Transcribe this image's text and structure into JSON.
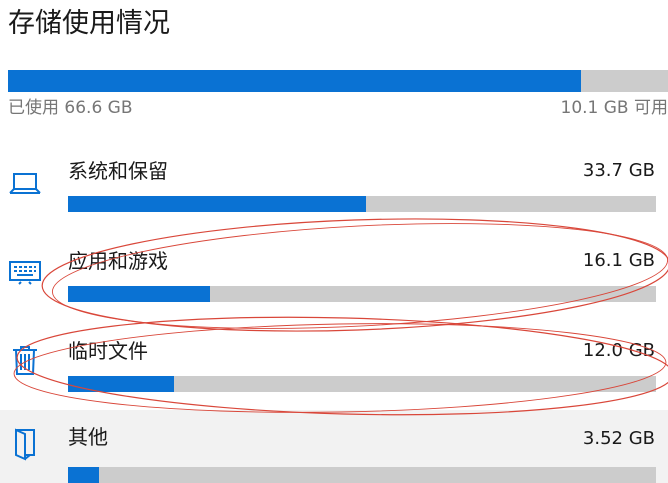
{
  "page": {
    "title": "存储使用情况"
  },
  "overview": {
    "used_label": "已使用 66.6 GB",
    "free_label": "10.1 GB 可用",
    "used_fraction": 0.868
  },
  "categories": [
    {
      "name": "系统和保留",
      "size": "33.7 GB",
      "fraction": 0.506,
      "icon": "laptop-icon"
    },
    {
      "name": "应用和游戏",
      "size": "16.1 GB",
      "fraction": 0.242,
      "icon": "keyboard-icon"
    },
    {
      "name": "临时文件",
      "size": "12.0 GB",
      "fraction": 0.18,
      "icon": "trash-icon"
    },
    {
      "name": "其他",
      "size": "3.52 GB",
      "fraction": 0.052,
      "icon": "folder-icon"
    }
  ],
  "colors": {
    "accent": "#0a72d3",
    "track": "#cccccc",
    "annotation": "#d9473a",
    "highlight_row": "#f2f2f2"
  }
}
